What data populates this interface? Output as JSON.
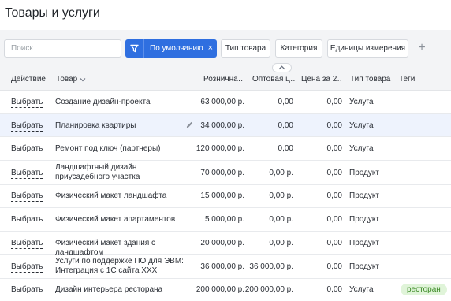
{
  "page": {
    "title": "Товары и услуги"
  },
  "toolbar": {
    "search_placeholder": "Поиск",
    "active_filter": "По умолчанию",
    "filter_close": "×",
    "pills": [
      "Тип товара",
      "Категория",
      "Единицы измерения"
    ],
    "add": "+"
  },
  "columns": {
    "action": "Действие",
    "product": "Товар",
    "retail": "Рознична…",
    "wholesale": "Оптовая ц…",
    "price2": "Цена за 2…",
    "type": "Тип товара",
    "tags": "Теги"
  },
  "rows": [
    {
      "action": "Выбрать",
      "name": "Создание дизайн-проекта",
      "retail": "63 000,00 р.",
      "wholesale": "0,00",
      "price2": "0,00",
      "type": "Услуга",
      "tag": ""
    },
    {
      "action": "Выбрать",
      "name": "Планировка квартиры",
      "retail": "34 000,00 р.",
      "wholesale": "0,00",
      "price2": "0,00",
      "type": "Услуга",
      "tag": ""
    },
    {
      "action": "Выбрать",
      "name": "Ремонт под ключ (партнеры)",
      "retail": "120 000,00 р.",
      "wholesale": "0,00",
      "price2": "0,00",
      "type": "Услуга",
      "tag": ""
    },
    {
      "action": "Выбрать",
      "name": "Ландшафтный дизайн приусадебного участка",
      "retail": "70 000,00 р.",
      "wholesale": "0,00 р.",
      "price2": "0,00",
      "type": "Продукт",
      "tag": ""
    },
    {
      "action": "Выбрать",
      "name": "Физический макет ландшафта",
      "retail": "15 000,00 р.",
      "wholesale": "0,00 р.",
      "price2": "0,00",
      "type": "Продукт",
      "tag": ""
    },
    {
      "action": "Выбрать",
      "name": "Физический макет апартаментов",
      "retail": "5 000,00 р.",
      "wholesale": "0,00 р.",
      "price2": "0,00",
      "type": "Продукт",
      "tag": ""
    },
    {
      "action": "Выбрать",
      "name": "Физический макет здания с ландшафтом",
      "retail": "20 000,00 р.",
      "wholesale": "0,00 р.",
      "price2": "0,00",
      "type": "Продукт",
      "tag": ""
    },
    {
      "action": "Выбрать",
      "name": "Услуги по поддержке ПО для ЭВМ: Интеграция с 1С сайта ХХХ",
      "retail": "36 000,00 р.",
      "wholesale": "36 000,00 р.",
      "price2": "0,00",
      "type": "Продукт",
      "tag": ""
    },
    {
      "action": "Выбрать",
      "name": "Дизайн интерьера ресторана",
      "retail": "200 000,00 р.",
      "wholesale": "200 000,00 р.",
      "price2": "0,00",
      "type": "Услуга",
      "tag": "ресторан"
    }
  ],
  "colors": {
    "accent": "#2f6fe0",
    "highlight_row": "#eef3fd",
    "tag_bg": "#e0f4d9",
    "tag_text": "#3b8a25"
  }
}
